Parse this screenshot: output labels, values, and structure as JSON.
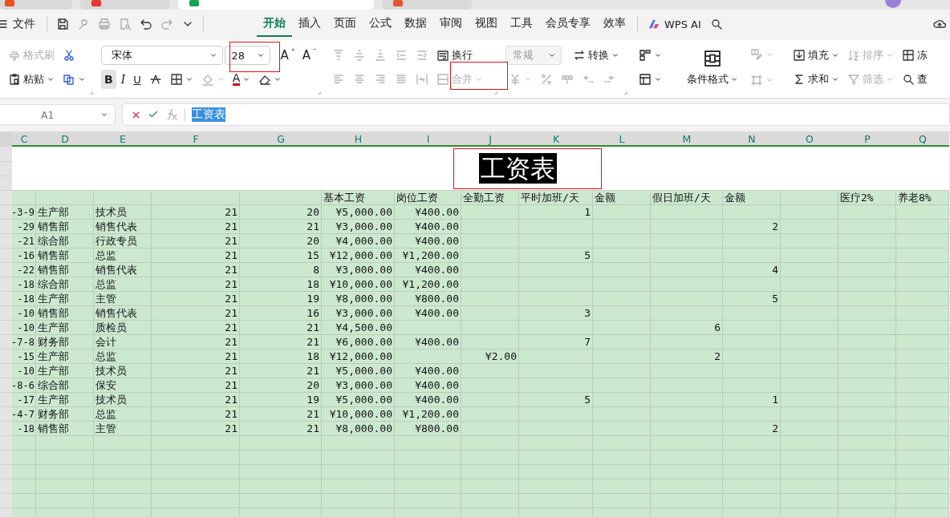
{
  "app_tabs": [
    {
      "selected": false,
      "color": "#e94e1b"
    },
    {
      "selected": false,
      "color": "#e53935"
    },
    {
      "selected": true,
      "color": "#1b9e55"
    },
    {
      "selected": false,
      "color": "#e8542e"
    }
  ],
  "menu": {
    "file_label": "文件",
    "tabs": [
      {
        "label": "开始",
        "selected": true
      },
      {
        "label": "插入",
        "selected": false
      },
      {
        "label": "页面",
        "selected": false
      },
      {
        "label": "公式",
        "selected": false
      },
      {
        "label": "数据",
        "selected": false
      },
      {
        "label": "审阅",
        "selected": false
      },
      {
        "label": "视图",
        "selected": false
      },
      {
        "label": "工具",
        "selected": false
      },
      {
        "label": "会员专享",
        "selected": false
      },
      {
        "label": "效率",
        "selected": false
      }
    ],
    "ai_label": "WPS AI"
  },
  "ribbon": {
    "format_painter": {
      "label": "格式刷",
      "disabled": true
    },
    "paste": {
      "label": "粘贴"
    },
    "font_name": {
      "value": "宋体"
    },
    "font_size": {
      "value": "28"
    },
    "grow_font": {
      "label": "A"
    },
    "shrink_font": {
      "label": "A"
    },
    "bold": {
      "label": "B",
      "on": true
    },
    "italic": {
      "label": "I"
    },
    "underline": {
      "label": "U"
    },
    "fill_color": {
      "disabled": true
    },
    "font_color": {
      "label": "A"
    },
    "alignment": {
      "disabled": true
    },
    "wrap": {
      "label": "换行"
    },
    "merge": {
      "label": "合并",
      "disabled": true
    },
    "number_format": {
      "value": "常规",
      "disabled": true
    },
    "convert": {
      "label": "转换"
    },
    "number_tools": {
      "disabled": true
    },
    "conditional_format": {
      "label": "条件格式"
    },
    "fill": {
      "label": "填充"
    },
    "sort": {
      "label": "排序",
      "disabled": true
    },
    "freeze": {
      "label": "冻"
    },
    "sum": {
      "label": "求和"
    },
    "filter": {
      "label": "筛选",
      "disabled": true
    },
    "find": {
      "label": "查"
    }
  },
  "formula_bar": {
    "name_box": "A1",
    "formula": "工资表",
    "formula_selected": true
  },
  "sheet": {
    "columns": [
      "C",
      "D",
      "E",
      "F",
      "G",
      "H",
      "I",
      "J",
      "K",
      "L",
      "M",
      "N",
      "O",
      "P",
      "Q"
    ],
    "title": {
      "text": "工资表",
      "selected": true
    },
    "rows": [
      {
        "kind": "header",
        "cells": {
          "H": "基本工资",
          "I": "岗位工资",
          "J": "全勤工资",
          "K": "平时加班/天",
          "L": "金额",
          "M": "假日加班/天",
          "N": "金额",
          "P": "医疗2%",
          "Q": "养老8%"
        }
      },
      {
        "kind": "data",
        "cells": {
          "C": "-3-9",
          "D": "生产部",
          "E": "技术员",
          "F": "21",
          "G": "20",
          "H": "¥5,000.00",
          "I": "¥400.00",
          "K": "1"
        }
      },
      {
        "kind": "data",
        "cells": {
          "C": "-29",
          "D": "销售部",
          "E": "销售代表",
          "F": "21",
          "G": "21",
          "H": "¥3,000.00",
          "I": "¥400.00",
          "N": "2"
        }
      },
      {
        "kind": "data",
        "cells": {
          "C": "-21",
          "D": "综合部",
          "E": "行政专员",
          "F": "21",
          "G": "20",
          "H": "¥4,000.00",
          "I": "¥400.00"
        }
      },
      {
        "kind": "data",
        "cells": {
          "C": "-16",
          "D": "销售部",
          "E": "总监",
          "F": "21",
          "G": "15",
          "H": "¥12,000.00",
          "I": "¥1,200.00",
          "K": "5"
        }
      },
      {
        "kind": "data",
        "cells": {
          "C": "-22",
          "D": "销售部",
          "E": "销售代表",
          "F": "21",
          "G": "8",
          "H": "¥3,000.00",
          "I": "¥400.00",
          "N": "4"
        }
      },
      {
        "kind": "data",
        "cells": {
          "C": "-18",
          "D": "综合部",
          "E": "总监",
          "F": "21",
          "G": "18",
          "H": "¥10,000.00",
          "I": "¥1,200.00"
        }
      },
      {
        "kind": "data",
        "cells": {
          "C": "-18",
          "D": "生产部",
          "E": "主管",
          "F": "21",
          "G": "19",
          "H": "¥8,000.00",
          "I": "¥800.00",
          "N": "5"
        }
      },
      {
        "kind": "data",
        "cells": {
          "C": "-10",
          "D": "销售部",
          "E": "销售代表",
          "F": "21",
          "G": "16",
          "H": "¥3,000.00",
          "I": "¥400.00",
          "K": "3"
        }
      },
      {
        "kind": "data",
        "cells": {
          "C": "-10",
          "D": "生产部",
          "E": "质检员",
          "F": "21",
          "G": "21",
          "H": "¥4,500.00",
          "M": "6"
        }
      },
      {
        "kind": "data",
        "cells": {
          "C": "-7-8",
          "D": "财务部",
          "E": "会计",
          "F": "21",
          "G": "21",
          "H": "¥6,000.00",
          "I": "¥400.00",
          "K": "7"
        }
      },
      {
        "kind": "data",
        "cells": {
          "C": "-15",
          "D": "生产部",
          "E": "总监",
          "F": "21",
          "G": "18",
          "H": "¥12,000.00",
          "J": "¥2.00",
          "M": "2"
        }
      },
      {
        "kind": "data",
        "cells": {
          "C": "-10",
          "D": "生产部",
          "E": "技术员",
          "F": "21",
          "G": "21",
          "H": "¥5,000.00",
          "I": "¥400.00"
        }
      },
      {
        "kind": "data",
        "cells": {
          "C": "-8-6",
          "D": "综合部",
          "E": "保安",
          "F": "21",
          "G": "20",
          "H": "¥3,000.00",
          "I": "¥400.00"
        }
      },
      {
        "kind": "data",
        "cells": {
          "C": "-17",
          "D": "生产部",
          "E": "技术员",
          "F": "21",
          "G": "19",
          "H": "¥5,000.00",
          "I": "¥400.00",
          "K": "5",
          "N": "1"
        }
      },
      {
        "kind": "data",
        "cells": {
          "C": "-4-7",
          "D": "财务部",
          "E": "总监",
          "F": "21",
          "G": "21",
          "H": "¥10,000.00",
          "I": "¥1,200.00"
        }
      },
      {
        "kind": "data",
        "cells": {
          "C": "-18",
          "D": "销售部",
          "E": "主管",
          "F": "21",
          "G": "21",
          "H": "¥8,000.00",
          "I": "¥800.00",
          "N": "2"
        }
      }
    ]
  }
}
